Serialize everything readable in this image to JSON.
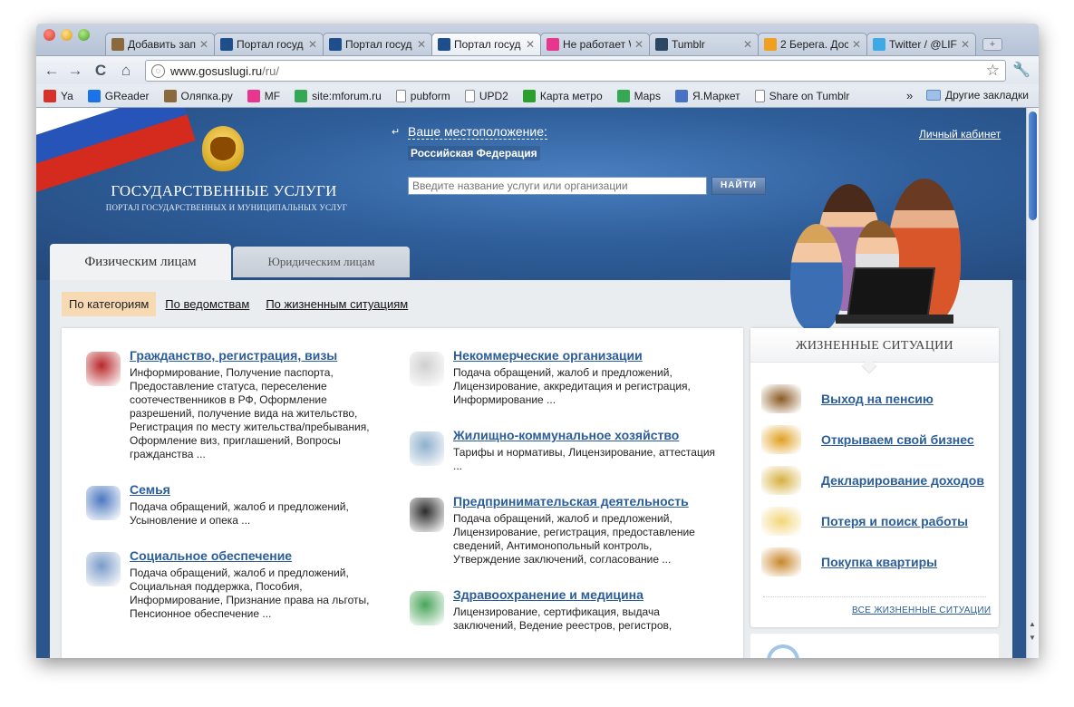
{
  "browser": {
    "tabs": [
      {
        "title": "Добавить запи",
        "fav_color": "#8a6a3c",
        "active": false
      },
      {
        "title": "Портал госуд",
        "fav_color": "#1e4f8c",
        "active": false
      },
      {
        "title": "Портал госуд",
        "fav_color": "#1e4f8c",
        "active": false
      },
      {
        "title": "Портал госуд",
        "fav_color": "#1e4f8c",
        "active": true
      },
      {
        "title": "Не работает W",
        "fav_color": "#e8368f",
        "active": false
      },
      {
        "title": "Tumblr",
        "fav_color": "#2c4762",
        "active": false
      },
      {
        "title": "2 Берега. Дос",
        "fav_color": "#f0a020",
        "active": false
      },
      {
        "title": "Twitter / @LIF",
        "fav_color": "#3fa9e6",
        "active": false
      }
    ],
    "url_host": "www.gosuslugi.ru",
    "url_path": "/ru/",
    "bookmarks": [
      {
        "label": "Ya",
        "icon": "yandex-icon",
        "color": "#d4322a"
      },
      {
        "label": "GReader",
        "icon": "greader-icon",
        "color": "#1a73e8"
      },
      {
        "label": "Оляпка.ру",
        "icon": "olyapka-icon",
        "color": "#8a6a3c"
      },
      {
        "label": "MF",
        "icon": "mf-icon",
        "color": "#e8368f"
      },
      {
        "label": "site:mforum.ru",
        "icon": "google-icon",
        "color": "#34a853"
      },
      {
        "label": "pubform",
        "icon": "page-icon",
        "color": "#cccccc"
      },
      {
        "label": "UPD2",
        "icon": "page-icon",
        "color": "#cccccc"
      },
      {
        "label": "Карта метро",
        "icon": "metro-icon",
        "color": "#2ca02c"
      },
      {
        "label": "Maps",
        "icon": "google-icon",
        "color": "#34a853"
      },
      {
        "label": "Я.Маркет",
        "icon": "market-icon",
        "color": "#4a72c4"
      },
      {
        "label": "Share on Tumblr",
        "icon": "page-icon",
        "color": "#cccccc"
      }
    ],
    "bookmarks_more": "»",
    "other_bookmarks": "Другие закладки"
  },
  "site": {
    "title": "ГОСУДАРСТВЕННЫЕ УСЛУГИ",
    "subtitle": "ПОРТАЛ ГОСУДАРСТВЕННЫХ И МУНИЦИПАЛЬНЫХ УСЛУГ",
    "location_label": "Ваше местоположение:",
    "location_value": "Российская Федерация",
    "search_placeholder": "Введите название услуги или организации",
    "search_button": "НАЙТИ",
    "cabinet_link": "Личный кабинет",
    "tab_individuals": "Физическим лицам",
    "tab_legal": "Юридическим лицам",
    "subnav": {
      "active": "По категориям",
      "by_agency": "По ведомствам",
      "by_life": "По жизненным ситуациям"
    }
  },
  "categories": [
    {
      "title": "Гражданство, регистрация, визы",
      "desc": "Информирование, Получение паспорта, Предоставление статуса, переселение соотечественников в РФ, Оформление разрешений, получение вида на жительство, Регистрация по месту жительства/пребывания, Оформление виз, приглашений, Вопросы гражданства ...",
      "icon": "passport-icon"
    },
    {
      "title": "Семья",
      "desc": "Подача обращений, жалоб и предложений, Усыновление и опека ...",
      "icon": "family-icon"
    },
    {
      "title": "Социальное обеспечение",
      "desc": "Подача обращений, жалоб и предложений, Социальная поддержка, Пособия, Информирование, Признание права на льготы, Пенсионное обеспечение ...",
      "icon": "social-icon"
    },
    {
      "title": "Некоммерческие организации",
      "desc": "Подача обращений, жалоб и предложений, Лицензирование, аккредитация и регистрация, Информирование ...",
      "icon": "dove-icon"
    },
    {
      "title": "Жилищно-коммунальное хозяйство",
      "desc": "Тарифы и нормативы, Лицензирование, аттестация ...",
      "icon": "faucet-icon"
    },
    {
      "title": "Предпринимательская деятельность",
      "desc": "Подача обращений, жалоб и предложений, Лицензирование, регистрация, предоставление сведений, Антимонопольный контроль, Утверждение заключений, согласование ...",
      "icon": "briefcase-icon"
    },
    {
      "title": "Здравоохранение и медицина",
      "desc": "Лицензирование, сертификация, выдача заключений, Ведение реестров, регистров,",
      "icon": "medicine-icon"
    }
  ],
  "life_situations": {
    "header": "ЖИЗНЕННЫЕ СИТУАЦИИ",
    "items": [
      {
        "label": "Выход на пенсию",
        "icon": "hat-icon"
      },
      {
        "label": "Открываем свой бизнес",
        "icon": "stall-icon"
      },
      {
        "label": "Декларирование доходов",
        "icon": "coins-icon"
      },
      {
        "label": "Потеря и поиск работы",
        "icon": "job-sign-icon"
      },
      {
        "label": "Покупка квартиры",
        "icon": "house-icon"
      }
    ],
    "all_link": "ВСЕ ЖИЗНЕННЫЕ СИТУАЦИИ"
  },
  "colors": {
    "link": "#2a5d9a",
    "hero": "#2f5f9b",
    "subnav_active": "#f7d9b4"
  }
}
